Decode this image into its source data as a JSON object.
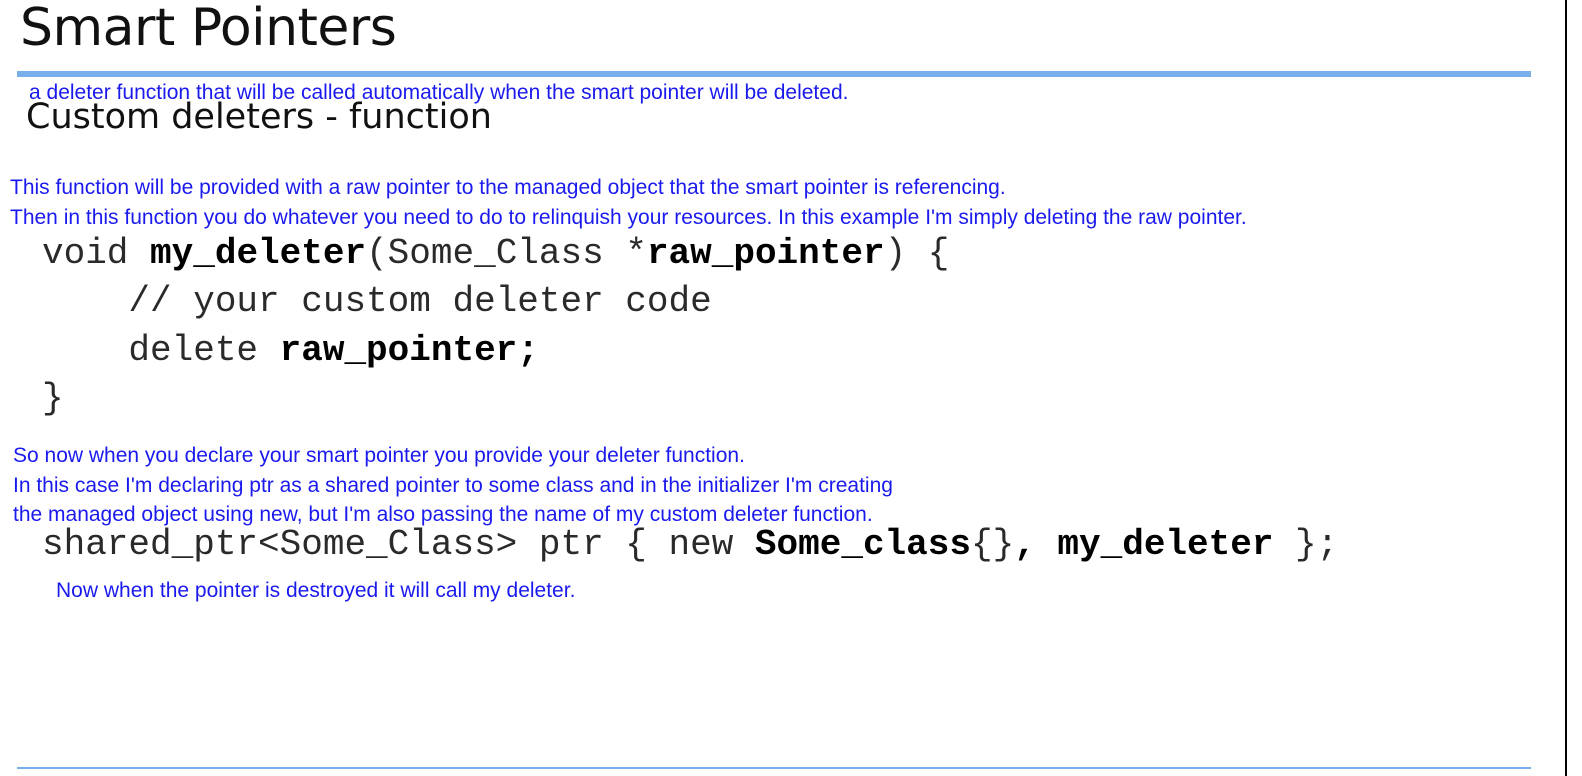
{
  "slide": {
    "title": "Smart Pointers",
    "subtitle": "Custom deleters - function"
  },
  "notes": {
    "deleter_intro": "a deleter function that will be called automatically when the smart pointer will be deleted.",
    "raw_pointer_line1": "This function will be provided with a raw pointer to the managed object that the smart pointer is referencing.",
    "raw_pointer_line2": "Then in this function you do whatever you need to do to relinquish your resources. In this example I'm simply deleting the raw pointer.",
    "declare_line1": "So now when you declare your smart pointer you provide your deleter function.",
    "declare_line2": "In this case I'm declaring ptr as a shared pointer to some class and in the initializer I'm creating",
    "declare_line3": "the managed object using new, but I'm also passing the name of my custom deleter function.",
    "destroyed": "Now when the pointer is destroyed it will call my deleter."
  },
  "code": {
    "fn_void": "void ",
    "fn_name": "my_deleter",
    "fn_params_open": "(Some_Class *",
    "fn_param_name": "raw_pointer",
    "fn_params_close": ") {",
    "comment": "    // your custom deleter code",
    "delete_kw": "    delete ",
    "delete_target": "raw_pointer;",
    "close_brace": "}",
    "decl_prefix": "shared_ptr<Some_Class> ptr { new ",
    "decl_class": "Some_class",
    "decl_braces": "{}",
    "decl_sep": ", ",
    "decl_deleter": "my_deleter",
    "decl_suffix": " };"
  },
  "colors": {
    "annotation": "#1a1aee",
    "rule": "#78aee9",
    "text": "#111111"
  }
}
